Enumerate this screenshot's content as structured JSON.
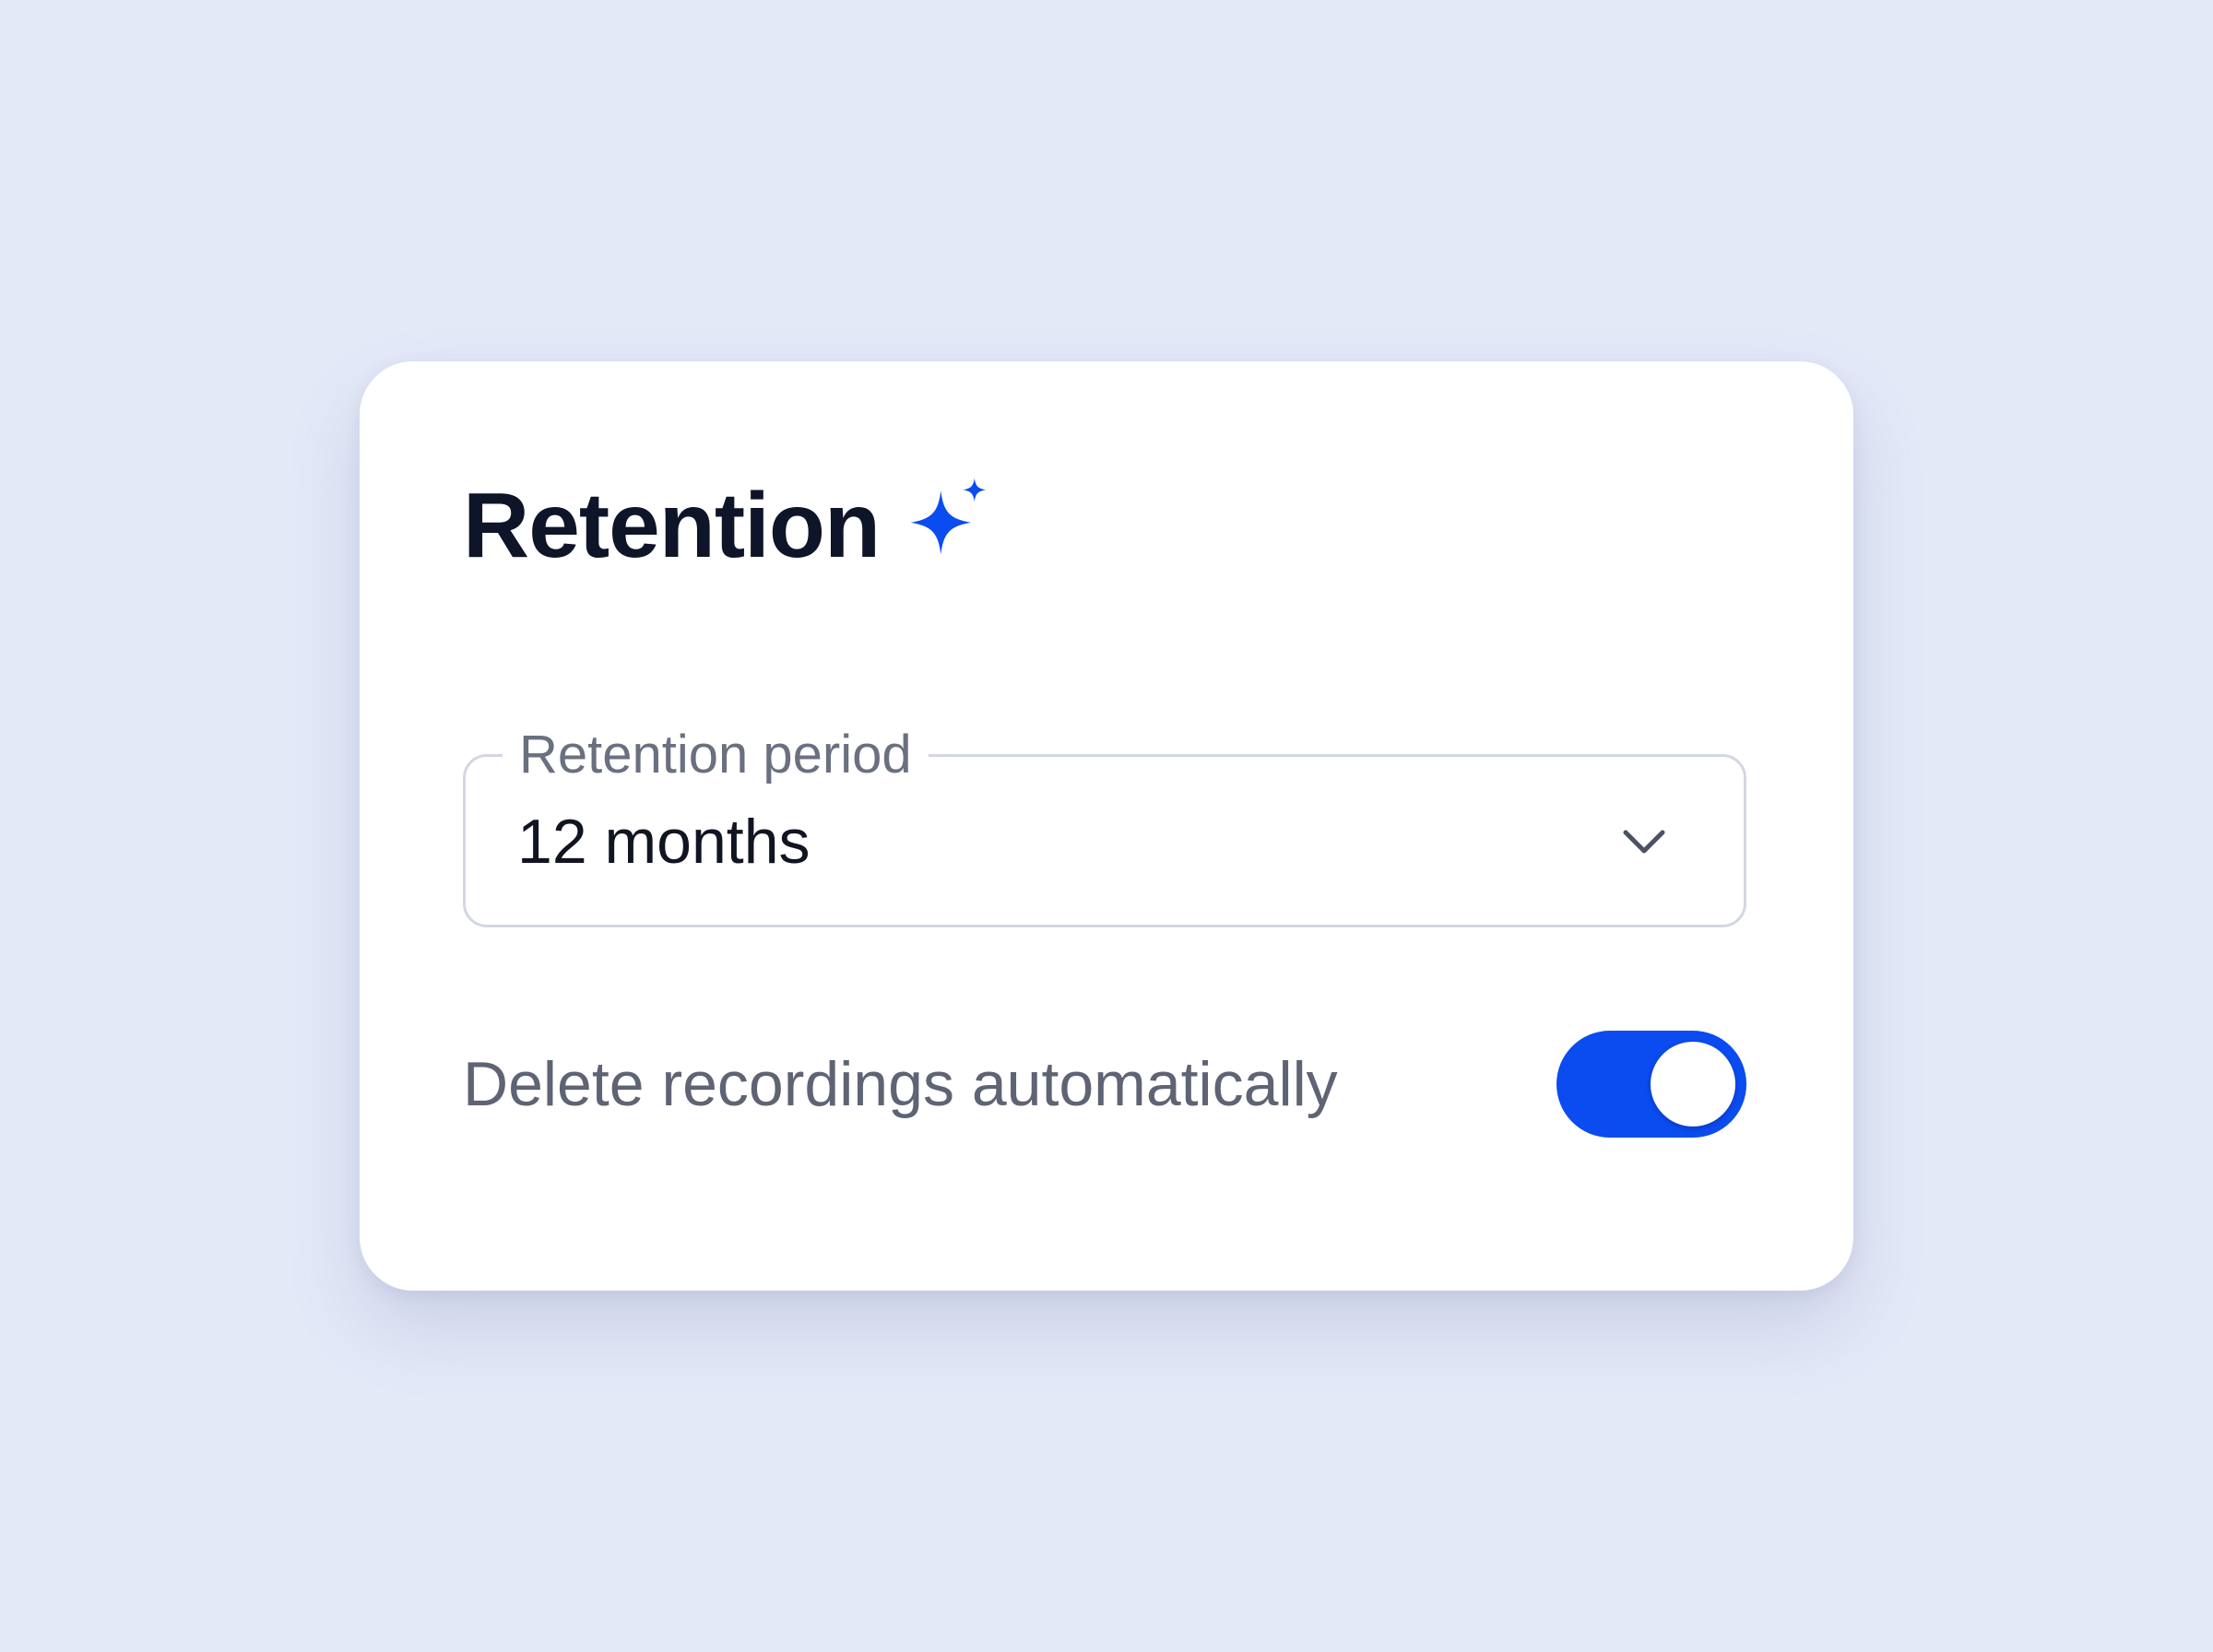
{
  "card": {
    "title": "Retention",
    "title_icon": "sparkle-icon"
  },
  "retention_period": {
    "label": "Retention period",
    "value": "12 months",
    "icon": "chevron-down-icon"
  },
  "auto_delete": {
    "label": "Delete recordings automatically",
    "enabled": true
  },
  "colors": {
    "accent": "#0a4cf0",
    "background": "#e4e9f8",
    "card": "#ffffff",
    "title_text": "#0f1528",
    "muted_text": "#5f6474",
    "border": "#d3d7e2"
  }
}
